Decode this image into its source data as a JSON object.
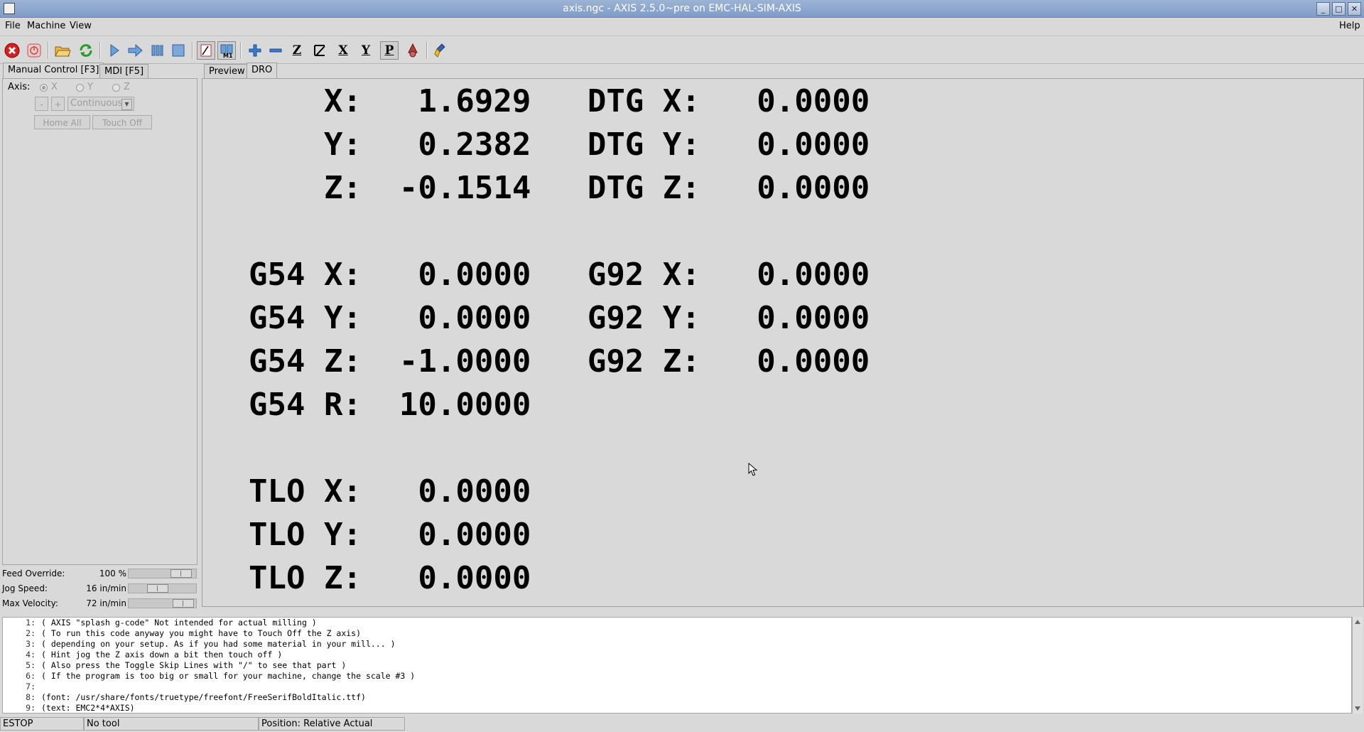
{
  "window": {
    "title": "axis.ngc - AXIS 2.5.0~pre on EMC-HAL-SIM-AXIS",
    "controls": [
      "_",
      "□",
      "✕"
    ]
  },
  "menu": {
    "file": "File",
    "machine": "Machine",
    "view": "View",
    "help": "Help"
  },
  "toolbar": {
    "icons": [
      "estop-icon",
      "machine-power-icon",
      "open-file-icon",
      "reload-icon",
      "run-icon",
      "step-icon",
      "pause-icon",
      "stop-icon",
      "block-delete-icon",
      "optional-stop-icon",
      "zoom-in-icon",
      "zoom-out-icon",
      "view-z-icon",
      "view-z2-icon",
      "view-x-icon",
      "view-y-icon",
      "view-p-icon",
      "rotate-icon",
      "clear-plot-icon"
    ],
    "letters": {
      "z": "Z",
      "x": "X",
      "y": "Y",
      "p": "P"
    }
  },
  "left_tabs": {
    "manual": "Manual Control [F3]",
    "mdi": "MDI [F5]"
  },
  "manual": {
    "axis_label": "Axis:",
    "axes": [
      "X",
      "Y",
      "Z"
    ],
    "minus": "-",
    "plus": "+",
    "jog_mode": "Continuous",
    "home_all": "Home All",
    "touch_off": "Touch Off"
  },
  "sliders": {
    "feed_override": {
      "label": "Feed Override:",
      "value": "100 %",
      "fraction": 0.9
    },
    "jog_speed": {
      "label": "Jog Speed:",
      "value": "16 in/min",
      "fraction": 0.4
    },
    "max_velocity": {
      "label": "Max Velocity:",
      "value": "72 in/min",
      "fraction": 0.95
    }
  },
  "right_tabs": {
    "preview": "Preview",
    "dro": "DRO"
  },
  "dro": {
    "lines": [
      "    X:   1.6929   DTG X:   0.0000",
      "    Y:   0.2382   DTG Y:   0.0000",
      "    Z:  -0.1514   DTG Z:   0.0000",
      "",
      "G54 X:   0.0000   G92 X:   0.0000",
      "G54 Y:   0.0000   G92 Y:   0.0000",
      "G54 Z:  -1.0000   G92 Z:   0.0000",
      "G54 R:  10.0000",
      "",
      "TLO X:   0.0000",
      "TLO Y:   0.0000",
      "TLO Z:   0.0000"
    ]
  },
  "gcode": [
    {
      "n": "1:",
      "text": "( AXIS \"splash g-code\" Not intended for actual milling )"
    },
    {
      "n": "2:",
      "text": "( To run this code anyway you might have to Touch Off the Z axis)"
    },
    {
      "n": "3:",
      "text": "( depending on your setup. As if you had some material in your mill... )"
    },
    {
      "n": "4:",
      "text": "( Hint jog the Z axis down a bit then touch off )"
    },
    {
      "n": "5:",
      "text": "( Also press the Toggle Skip Lines with \"/\" to see that part )"
    },
    {
      "n": "6:",
      "text": "( If the program is too big or small for your machine, change the scale #3 )"
    },
    {
      "n": "7:",
      "text": ""
    },
    {
      "n": "8:",
      "text": "(font: /usr/share/fonts/truetype/freefont/FreeSerifBoldItalic.ttf)"
    },
    {
      "n": "9:",
      "text": "(text: EMC2*4*AXIS)"
    }
  ],
  "status": {
    "estop": "ESTOP",
    "tool": "No tool",
    "position": "Position: Relative Actual"
  },
  "colors": {
    "background": "#d9d9d9",
    "titlebar": "#8ca6cf",
    "estop_red": "#d62020"
  }
}
